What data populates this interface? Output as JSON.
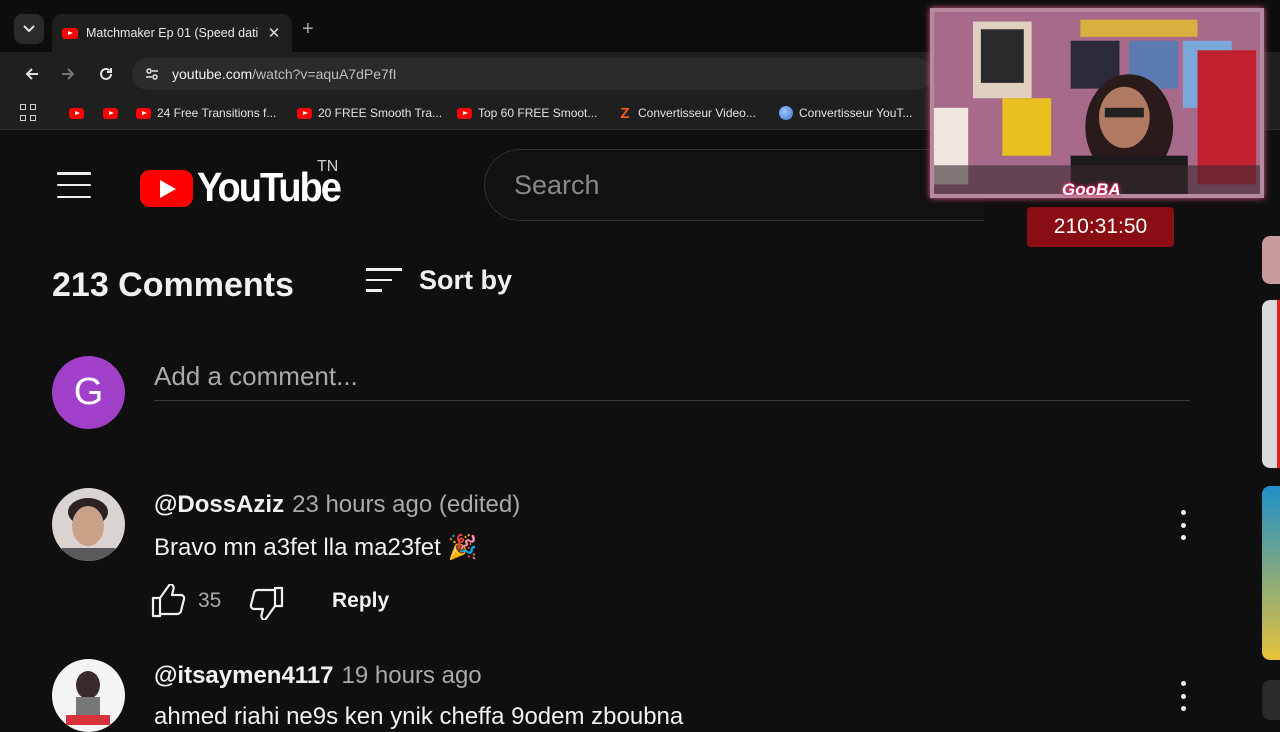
{
  "browser": {
    "tab_title": "Matchmaker Ep 01 (Speed dating",
    "url_host": "youtube.com",
    "url_path": "/watch?v=aquA7dPe7fI",
    "bookmarks": [
      {
        "label": "",
        "icon": "youtube-icon"
      },
      {
        "label": "",
        "icon": "youtube-icon"
      },
      {
        "label": "24 Free Transitions f...",
        "icon": "youtube-icon"
      },
      {
        "label": "20 FREE Smooth Tra...",
        "icon": "youtube-icon"
      },
      {
        "label": "Top 60 FREE Smoot...",
        "icon": "youtube-icon"
      },
      {
        "label": "Convertisseur Video...",
        "icon": "z-icon"
      },
      {
        "label": "Convertisseur YouT...",
        "icon": "s-icon"
      }
    ]
  },
  "youtube": {
    "country": "TN",
    "logo_text": "YouTube",
    "search_placeholder": "Search"
  },
  "comments": {
    "count_label": "213 Comments",
    "sort_label": "Sort by",
    "user_initial": "G",
    "add_placeholder": "Add a comment...",
    "items": [
      {
        "author": "@DossAziz",
        "time": "23 hours ago (edited)",
        "text": "Bravo mn a3fet lla ma23fet 🎉",
        "likes": "35",
        "reply": "Reply"
      },
      {
        "author": "@itsaymen4117",
        "time": "19 hours ago",
        "text": "ahmed riahi ne9s ken ynik cheffa 9odem zboubna"
      }
    ]
  },
  "overlay": {
    "name_tag": "GooBA",
    "timer": "210:31:50"
  },
  "colors": {
    "background": "#0f0f0f",
    "youtube_red": "#ff0000",
    "avatar_purple": "#a040c8",
    "timer_bg": "#8b0d14"
  }
}
